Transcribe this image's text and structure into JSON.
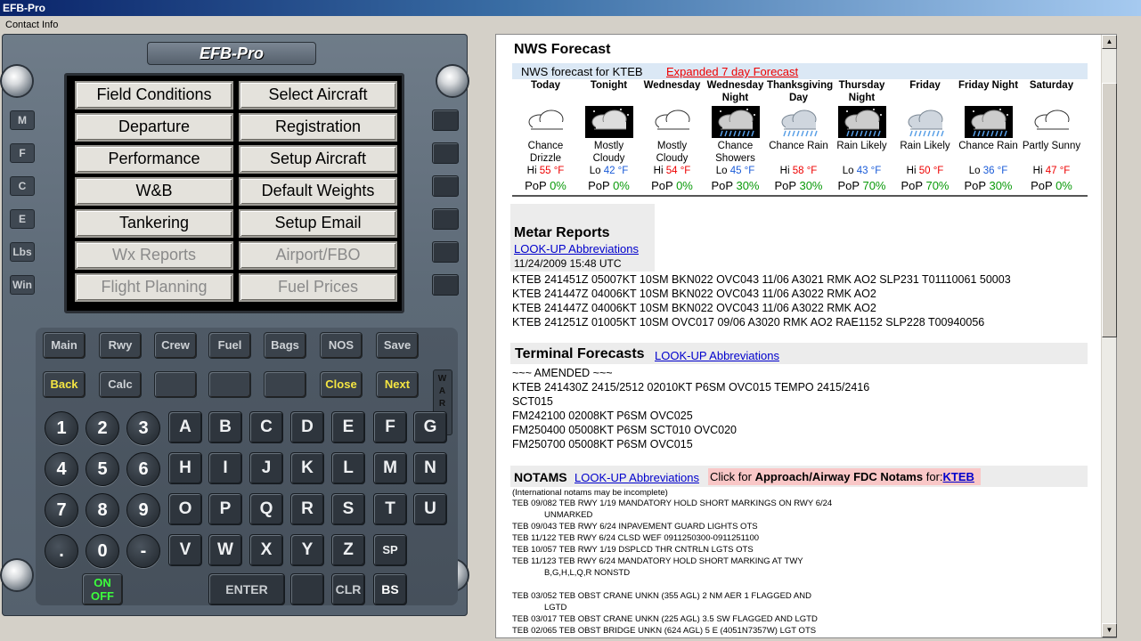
{
  "window": {
    "title": "EFB-Pro"
  },
  "menu": {
    "contact": "Contact Info"
  },
  "fmc": {
    "title": "EFB-Pro",
    "screen_buttons": [
      {
        "label": "Field Conditions",
        "enabled": true
      },
      {
        "label": "Select Aircraft",
        "enabled": true
      },
      {
        "label": "Departure",
        "enabled": true
      },
      {
        "label": "Registration",
        "enabled": true
      },
      {
        "label": "Performance",
        "enabled": true
      },
      {
        "label": "Setup Aircraft",
        "enabled": true
      },
      {
        "label": "W&B",
        "enabled": true
      },
      {
        "label": "Default Weights",
        "enabled": true
      },
      {
        "label": "Tankering",
        "enabled": true
      },
      {
        "label": "Setup Email",
        "enabled": true
      },
      {
        "label": "Wx Reports",
        "enabled": false
      },
      {
        "label": "Airport/FBO",
        "enabled": false
      },
      {
        "label": "Flight Planning",
        "enabled": false
      },
      {
        "label": "Fuel Prices",
        "enabled": false
      }
    ],
    "side_labels": [
      "M",
      "F",
      "C",
      "E",
      "Lbs",
      "Win"
    ],
    "func_row1": [
      "Main",
      "Rwy",
      "Crew",
      "Fuel",
      "Bags",
      "NOS",
      "Save"
    ],
    "func_row2": [
      "Back",
      "Calc",
      "",
      "",
      "",
      "Close",
      "Next"
    ],
    "warn": "WARN",
    "numeric_rows": [
      [
        "1",
        "2",
        "3"
      ],
      [
        "4",
        "5",
        "6"
      ],
      [
        "7",
        "8",
        "9"
      ],
      [
        ".",
        "0",
        "-"
      ]
    ],
    "alpha_rows": [
      [
        "A",
        "B",
        "C",
        "D",
        "F",
        "G"
      ],
      [
        "H",
        "I",
        "J",
        "K",
        "L",
        "M",
        "N"
      ],
      [
        "O",
        "P",
        "Q",
        "R",
        "S",
        "T",
        "U"
      ],
      [
        "V",
        "W",
        "X",
        "Y",
        "Z",
        "SP"
      ]
    ],
    "on_off": "ON\nOFF",
    "enter": "ENTER",
    "clr": "CLR",
    "bs": "BS"
  },
  "nws": {
    "heading": "NWS Forecast",
    "subheading": "NWS forecast for KTEB",
    "expanded_link": "Expanded 7 day Forecast",
    "periods": [
      {
        "name": "Today",
        "desc": "Chance Drizzle",
        "hilo": "Hi",
        "temp": "55 °F",
        "pop": "0%",
        "icon": "partly-cloudy-day-icon"
      },
      {
        "name": "Tonight",
        "desc": "Mostly Cloudy",
        "hilo": "Lo",
        "temp": "42 °F",
        "pop": "0%",
        "icon": "cloudy-night-icon"
      },
      {
        "name": "Wednesday",
        "desc": "Mostly Cloudy",
        "hilo": "Hi",
        "temp": "54 °F",
        "pop": "0%",
        "icon": "mostly-cloudy-icon"
      },
      {
        "name": "Wednesday Night",
        "desc": "Chance Showers",
        "hilo": "Lo",
        "temp": "45 °F",
        "pop": "30%",
        "icon": "showers-night-icon"
      },
      {
        "name": "Thanksgiving Day",
        "desc": "Chance Rain",
        "hilo": "Hi",
        "temp": "58 °F",
        "pop": "30%",
        "icon": "rain-icon"
      },
      {
        "name": "Thursday Night",
        "desc": "Rain Likely",
        "hilo": "Lo",
        "temp": "43 °F",
        "pop": "70%",
        "icon": "rain-night-icon"
      },
      {
        "name": "Friday",
        "desc": "Rain Likely",
        "hilo": "Hi",
        "temp": "50 °F",
        "pop": "70%",
        "icon": "rain-icon"
      },
      {
        "name": "Friday Night",
        "desc": "Chance Rain",
        "hilo": "Lo",
        "temp": "36 °F",
        "pop": "30%",
        "icon": "rain-night-icon"
      },
      {
        "name": "Saturday",
        "desc": "Partly Sunny",
        "hilo": "Hi",
        "temp": "47 °F",
        "pop": "0%",
        "icon": "partly-sunny-icon"
      }
    ],
    "pop_label": "PoP"
  },
  "metar": {
    "heading": "Metar Reports",
    "lookup": "LOOK-UP Abbreviations",
    "timestamp": "11/24/2009 15:48 UTC",
    "lines": [
      "KTEB 241451Z 05007KT 10SM BKN022 OVC043 11/06 A3021 RMK AO2 SLP231 T01110061 50003",
      "KTEB 241447Z 04006KT 10SM BKN022 OVC043 11/06 A3022 RMK AO2",
      "KTEB 241447Z 04006KT 10SM BKN022 OVC043 11/06 A3022 RMK AO2",
      "KTEB 241251Z 01005KT 10SM OVC017 09/06 A3020 RMK AO2 RAE1152 SLP228 T00940056"
    ]
  },
  "taf": {
    "heading": "Terminal Forecasts",
    "lookup": "LOOK-UP Abbreviations",
    "lines": [
      "~~~ AMENDED ~~~",
      "KTEB 241430Z 2415/2512 02010KT P6SM OVC015 TEMPO 2415/2416",
      "SCT015",
      "FM242100 02008KT P6SM OVC025",
      "FM250400 05008KT P6SM SCT010 OVC020",
      "FM250700 05008KT P6SM OVC015"
    ]
  },
  "notams": {
    "heading": "NOTAMS",
    "lookup": "LOOK-UP Abbreviations",
    "fdc_prefix": "Click for ",
    "fdc_bold": "Approach/Airway FDC Notams",
    "fdc_for": " for:",
    "fdc_link": "KTEB",
    "note": "(International notams may be incomplete)",
    "lines": [
      "TEB 09/082 TEB RWY 1/19 MANDATORY HOLD SHORT MARKINGS ON RWY 6/24",
      "UNMARKED",
      "TEB 09/043 TEB RWY 6/24 INPAVEMENT GUARD LIGHTS OTS",
      "TEB 11/122 TEB RWY 6/24 CLSD WEF 0911250300-0911251100",
      "TEB 10/057 TEB RWY 1/19 DSPLCD THR CNTRLN LGTS OTS",
      "TEB 11/123 TEB RWY 6/24 MANDATORY HOLD SHORT MARKING AT TWY",
      "B,G,H,L,Q,R NONSTD",
      "",
      "TEB 03/052 TEB OBST CRANE UNKN (355 AGL) 2 NM AER 1 FLAGGED AND",
      "LGTD",
      "TEB 03/017 TEB OBST CRANE UNKN (225 AGL) 3.5 SW FLAGGED AND LGTD",
      "TEB 02/065 TEB OBST BRIDGE UNKN (624 AGL) 5 E (4051N7357W) LGT OTS"
    ]
  }
}
